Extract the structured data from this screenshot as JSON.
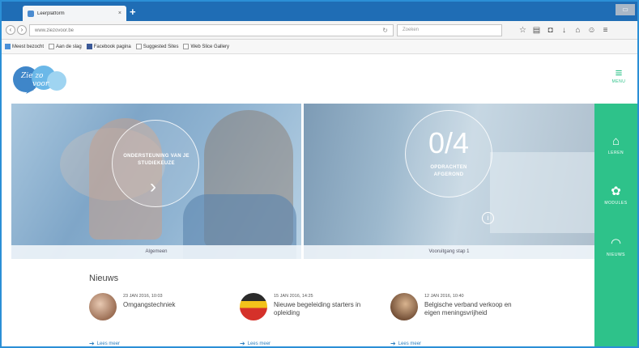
{
  "browser": {
    "tab_title": "Leerplatform",
    "tab_close": "×",
    "new_tab": "+",
    "window_button": "▭",
    "url": "www.ziezovoor.be",
    "search_placeholder": "Zoeken",
    "bookmarks": [
      {
        "label": "Meest bezocht",
        "icon": "bookmark-icon"
      },
      {
        "label": "Aan de slag",
        "icon": "bookmark-icon"
      },
      {
        "label": "Facebook pagina",
        "icon": "facebook-icon"
      },
      {
        "label": "Suggested Sites",
        "icon": "bookmark-icon"
      },
      {
        "label": "Web Slice Gallery",
        "icon": "bookmark-icon"
      }
    ]
  },
  "site": {
    "logo_line1": "Zie zo",
    "logo_line2": "voor",
    "menu_label": "MENU"
  },
  "hero": {
    "left": {
      "circle_text": "ONDERSTEUNING VAN JE STUDIEKEUZE",
      "arrow": "›",
      "caption": "Algemeen"
    },
    "right": {
      "progress": "0/4",
      "circle_text": "OPDRACHTEN AFGEROND",
      "info": "i",
      "caption": "Vooruitgang stap 1"
    }
  },
  "sidebar": {
    "items": [
      {
        "label": "LEREN",
        "icon": "home-icon",
        "glyph": "⌂"
      },
      {
        "label": "MODULES",
        "icon": "modules-icon",
        "glyph": "✿"
      },
      {
        "label": "NIEUWS",
        "icon": "rss-icon",
        "glyph": "◠"
      }
    ]
  },
  "news": {
    "title": "Nieuws",
    "items": [
      {
        "date": "23 JAN 2016, 10:03",
        "headline": "Omgangstechniek",
        "more": "Lees meer"
      },
      {
        "date": "15 JAN 2016, 14:25",
        "headline": "Nieuwe begeleiding starters in opleiding",
        "more": "Lees meer"
      },
      {
        "date": "12 JAN 2016, 10:40",
        "headline": "Belgische verband verkoop en eigen meningsvrijheid",
        "more": "Lees meer"
      }
    ]
  },
  "colors": {
    "accent": "#2ec28a",
    "browser_blue": "#1f6db5"
  }
}
